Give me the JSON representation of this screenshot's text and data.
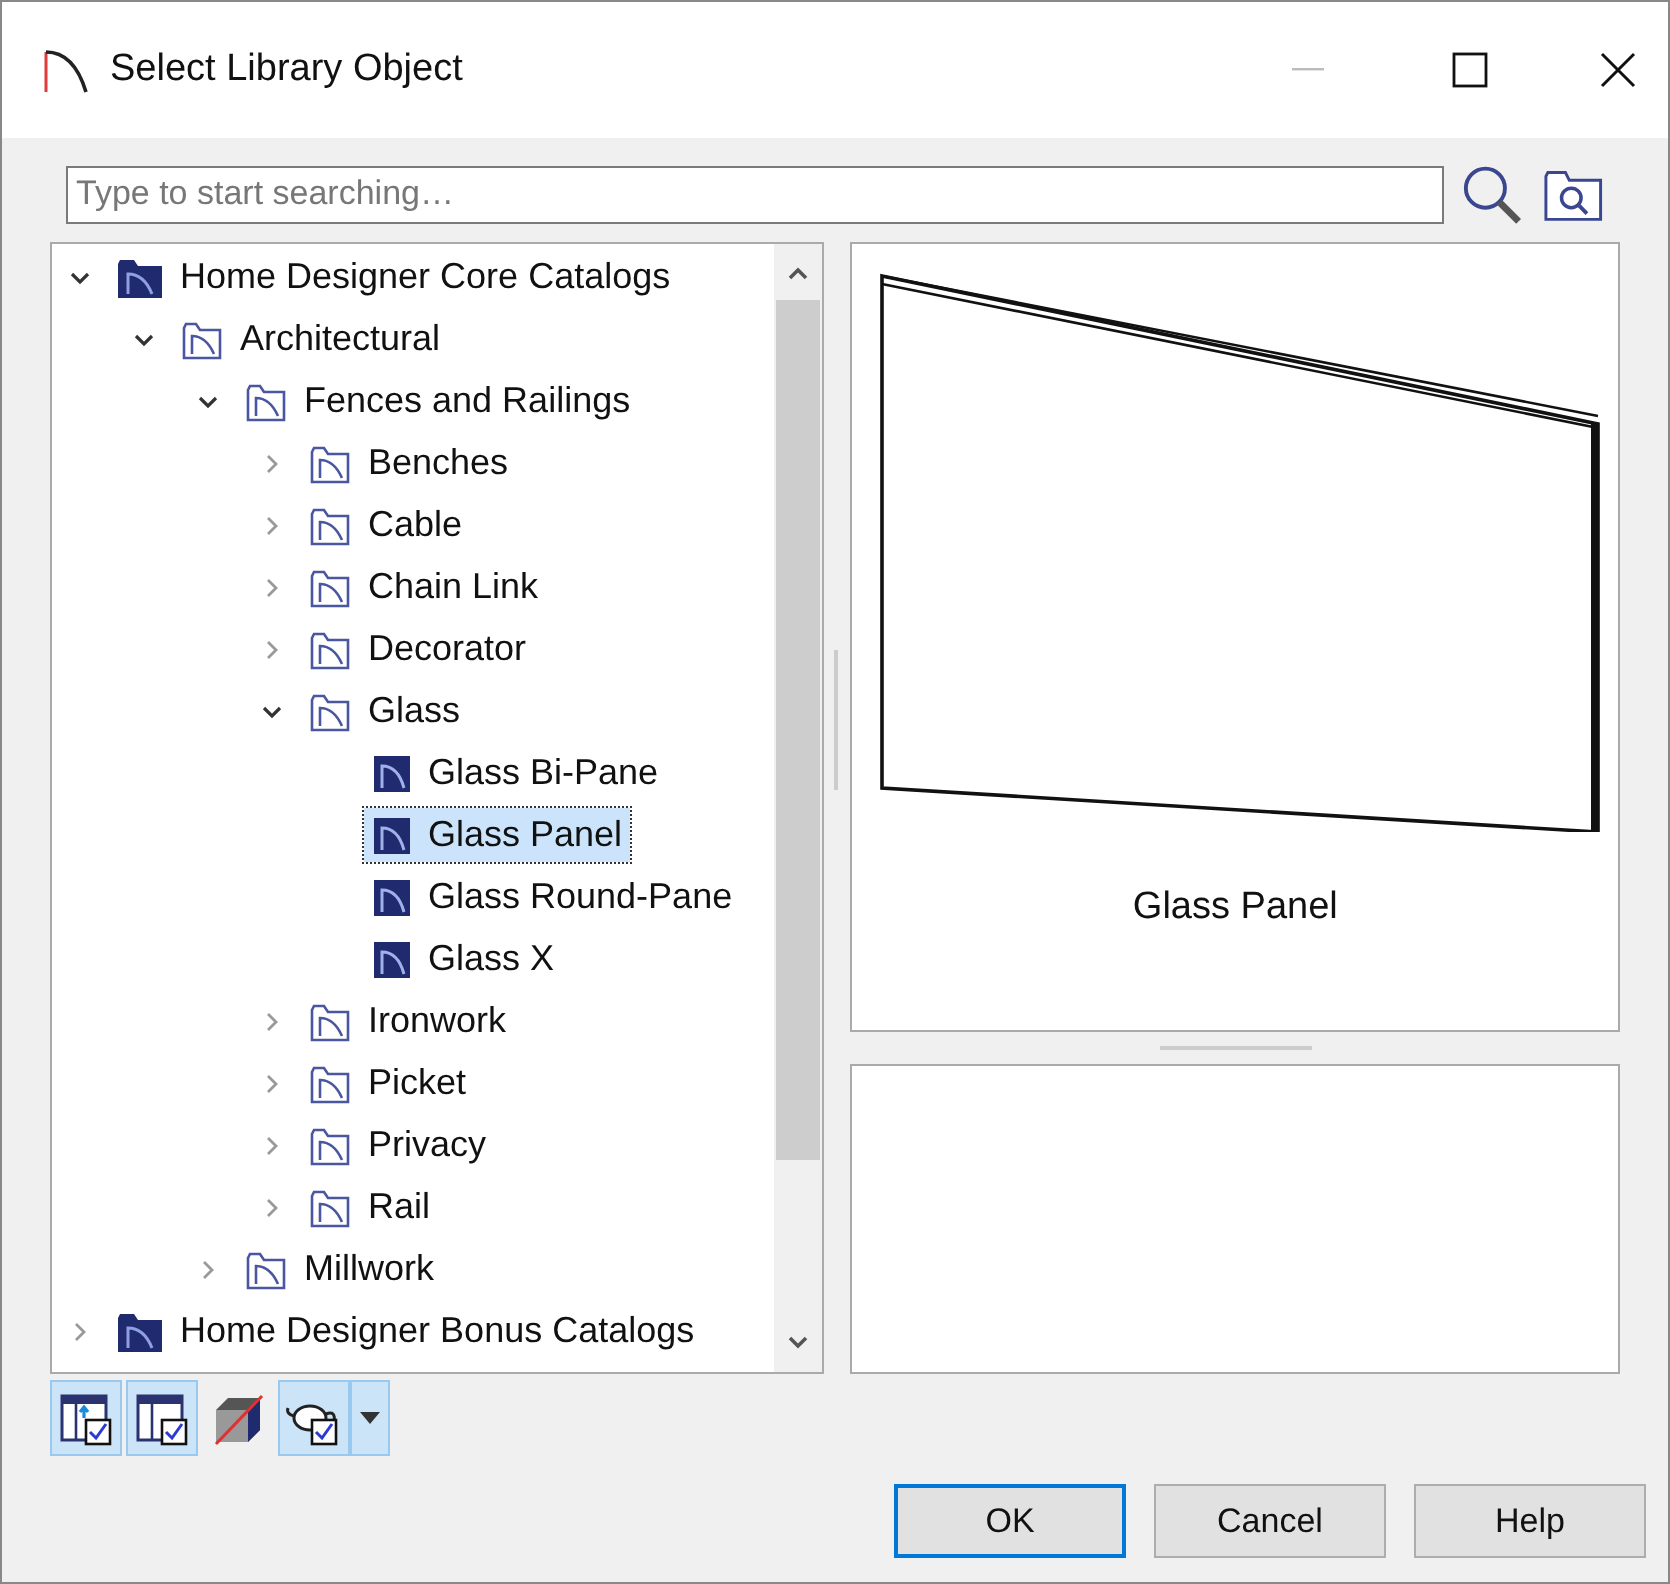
{
  "window": {
    "title": "Select Library Object"
  },
  "search": {
    "placeholder": "Type to start searching…"
  },
  "tree": [
    {
      "kind": "catalog",
      "label": "Home Designer Core Catalogs",
      "expanded": true,
      "selected": false,
      "children": [
        {
          "kind": "folder",
          "label": "Architectural",
          "expanded": true,
          "selected": false,
          "children": [
            {
              "kind": "folder",
              "label": "Fences and Railings",
              "expanded": true,
              "selected": false,
              "children": [
                {
                  "kind": "folder",
                  "label": "Benches",
                  "expanded": false,
                  "selected": false
                },
                {
                  "kind": "folder",
                  "label": "Cable",
                  "expanded": false,
                  "selected": false
                },
                {
                  "kind": "folder",
                  "label": "Chain Link",
                  "expanded": false,
                  "selected": false
                },
                {
                  "kind": "folder",
                  "label": "Decorator",
                  "expanded": false,
                  "selected": false
                },
                {
                  "kind": "folder",
                  "label": "Glass",
                  "expanded": true,
                  "selected": false,
                  "children": [
                    {
                      "kind": "item",
                      "label": "Glass Bi-Pane",
                      "selected": false
                    },
                    {
                      "kind": "item",
                      "label": "Glass Panel",
                      "selected": true
                    },
                    {
                      "kind": "item",
                      "label": "Glass Round-Pane",
                      "selected": false
                    },
                    {
                      "kind": "item",
                      "label": "Glass X",
                      "selected": false
                    }
                  ]
                },
                {
                  "kind": "folder",
                  "label": "Ironwork",
                  "expanded": false,
                  "selected": false
                },
                {
                  "kind": "folder",
                  "label": "Picket",
                  "expanded": false,
                  "selected": false
                },
                {
                  "kind": "folder",
                  "label": "Privacy",
                  "expanded": false,
                  "selected": false
                },
                {
                  "kind": "folder",
                  "label": "Rail",
                  "expanded": false,
                  "selected": false
                }
              ]
            },
            {
              "kind": "folder",
              "label": "Millwork",
              "expanded": false,
              "selected": false
            }
          ]
        }
      ]
    },
    {
      "kind": "catalog",
      "label": "Home Designer Bonus Catalogs",
      "expanded": false,
      "selected": false
    }
  ],
  "toolbar": [
    {
      "kind": "library-up",
      "on": true
    },
    {
      "kind": "library",
      "on": true
    },
    {
      "kind": "cube",
      "on": false
    },
    {
      "kind": "teapot",
      "on": true
    }
  ],
  "preview": {
    "caption": "Glass Panel"
  },
  "buttons": [
    "OK",
    "Cancel",
    "Help"
  ]
}
